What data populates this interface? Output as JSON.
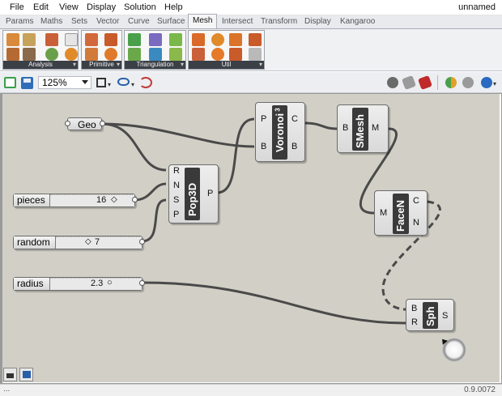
{
  "app": {
    "document_name": "unnamed"
  },
  "menu": [
    "File",
    "Edit",
    "View",
    "Display",
    "Solution",
    "Help"
  ],
  "tabs": [
    "Params",
    "Maths",
    "Sets",
    "Vector",
    "Curve",
    "Surface",
    "Mesh",
    "Intersect",
    "Transform",
    "Display",
    "Kangaroo"
  ],
  "active_tab": "Mesh",
  "ribbon_groups": [
    "Analysis",
    "Primitive",
    "Triangulation",
    "Util"
  ],
  "toolbar": {
    "zoom": "125%"
  },
  "components": {
    "geo": {
      "label": "Geo"
    },
    "pop3d": {
      "title": "Pop3D",
      "inputs": [
        "R",
        "N",
        "S",
        "P"
      ],
      "output": "P"
    },
    "voronoi": {
      "title": "Voronoi",
      "superscript": "3",
      "inputs": [
        "P",
        "B"
      ],
      "outputs": [
        "C",
        "B"
      ]
    },
    "smesh": {
      "title": "SMesh",
      "input": "B",
      "output": "M"
    },
    "facen": {
      "title": "FaceN",
      "input": "M",
      "outputs": [
        "C",
        "N"
      ]
    },
    "sph": {
      "title": "Sph",
      "inputs": [
        "B",
        "R"
      ],
      "output": "S"
    }
  },
  "sliders": {
    "pieces": {
      "label": "pieces",
      "value": "16"
    },
    "random": {
      "label": "random",
      "value": "7"
    },
    "radius": {
      "label": "radius",
      "value": "2.3"
    }
  },
  "status": {
    "left": "...",
    "version": "0.9.0072"
  },
  "colors": {
    "canvas": "#d2d0c6",
    "component_title_bg": "#3a3a3a",
    "wire": "#4a4a4a"
  }
}
